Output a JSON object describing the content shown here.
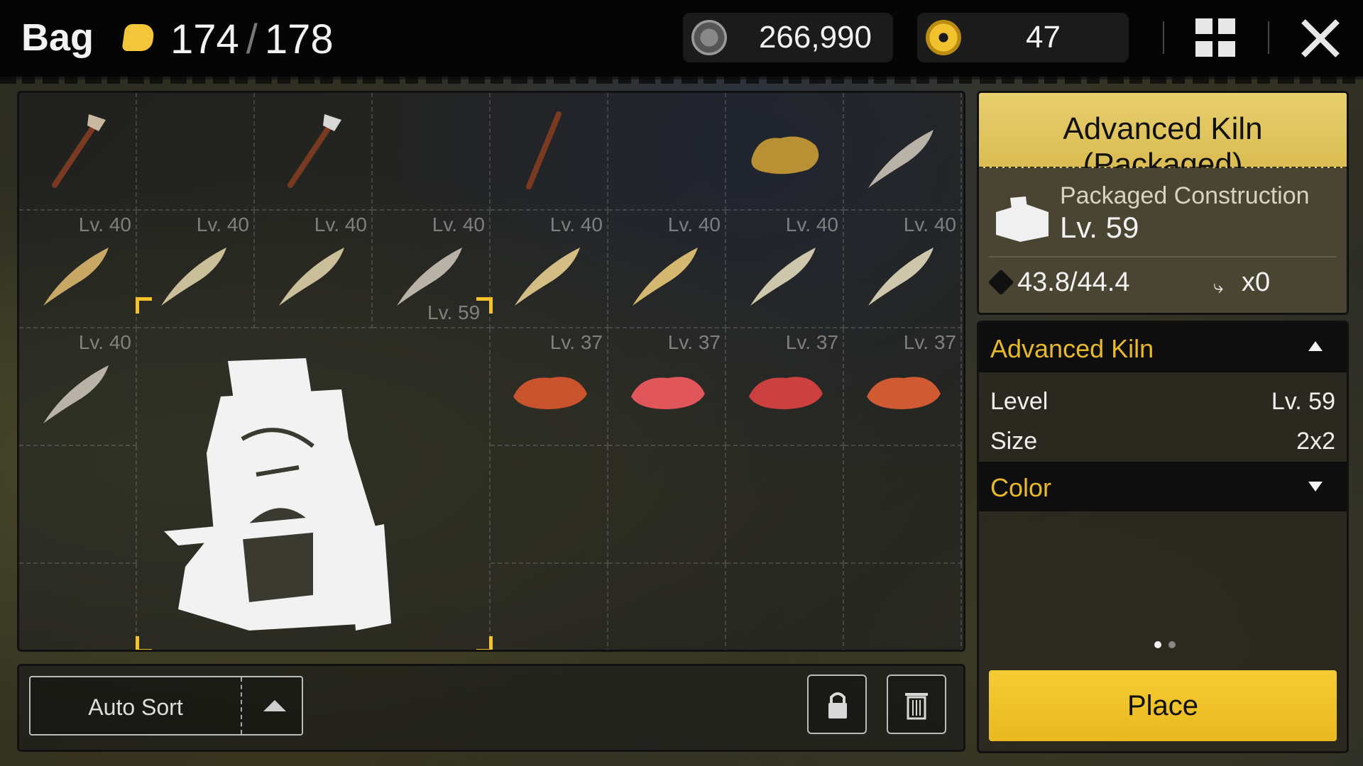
{
  "header": {
    "title": "Bag",
    "capacity_current": "174",
    "capacity_separator": "/",
    "capacity_max": "178",
    "currency_silver": "266,990",
    "currency_gold": "47"
  },
  "inventory": {
    "row1": [
      {
        "item": "stick-axe"
      },
      {
        "item": "stick-axe"
      },
      {
        "item": "stick"
      },
      {
        "item": "ore"
      },
      {
        "item": "feather"
      }
    ],
    "row2_levels": [
      "Lv. 40",
      "Lv. 40",
      "Lv. 40",
      "Lv. 40",
      "Lv. 40",
      "Lv. 40",
      "Lv. 40",
      "Lv. 40"
    ],
    "row3": {
      "feather_level": "Lv. 40",
      "selected_level": "Lv. 59",
      "meat_levels": [
        "Lv. 37",
        "Lv. 37",
        "Lv. 37",
        "Lv. 37"
      ]
    }
  },
  "toolbar": {
    "auto_sort_label": "Auto Sort"
  },
  "detail": {
    "title": "Advanced Kiln (Packaged)",
    "type": "Packaged Construction",
    "level": "Lv. 59",
    "weight": "43.8/44.4",
    "count": "x0"
  },
  "info": {
    "section_title": "Advanced Kiln",
    "rows": [
      {
        "key": "Level",
        "value": "Lv. 59"
      },
      {
        "key": "Size",
        "value": "2x2"
      }
    ],
    "color_section": "Color",
    "page_dots": 2,
    "active_dot": 0,
    "place_label": "Place"
  },
  "colors": {
    "accent_yellow": "#f4c32a",
    "panel_dark": "#0e0e0e",
    "feather_gold": "#c9a866",
    "feather_grey": "#b8b3a6",
    "meat_red": "#d85b3c"
  }
}
